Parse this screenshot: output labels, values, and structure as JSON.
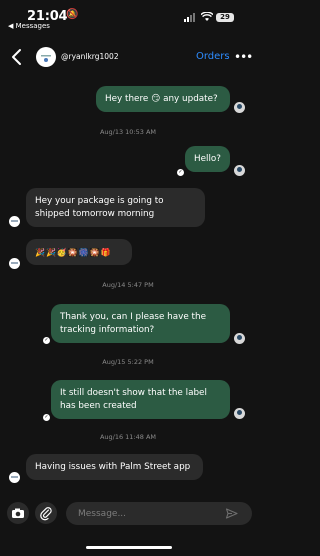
{
  "status_bar": {
    "time": "21:04",
    "back_label": "◀ Messages",
    "battery": "29"
  },
  "header": {
    "username": "@ryanlkrg1002",
    "orders_label": "Orders"
  },
  "messages": [
    {
      "text": "Hey there 😏 any update?"
    },
    {
      "text": "Aug/13 10:53 AM"
    },
    {
      "text": "Hello?"
    },
    {
      "text": "Hey your package is going to shipped tomorrow morning"
    },
    {
      "text": "🎉🎉🥳🎇🎆🎇🎁"
    },
    {
      "text": "Aug/14 5:47 PM"
    },
    {
      "text": "Thank you, can I please have the tracking information?"
    },
    {
      "text": "Aug/15 5:22 PM"
    },
    {
      "text": "It still doesn't show that the label has been created"
    },
    {
      "text": "Aug/16 11:48 AM"
    },
    {
      "text": "Having issues with Palm Street app"
    }
  ],
  "composer": {
    "placeholder": "Message..."
  },
  "colors": {
    "outgoing_bubble": "#2c5b43",
    "incoming_bubble": "#2b2b2b",
    "accent": "#2d8cff",
    "background": "#131313"
  }
}
